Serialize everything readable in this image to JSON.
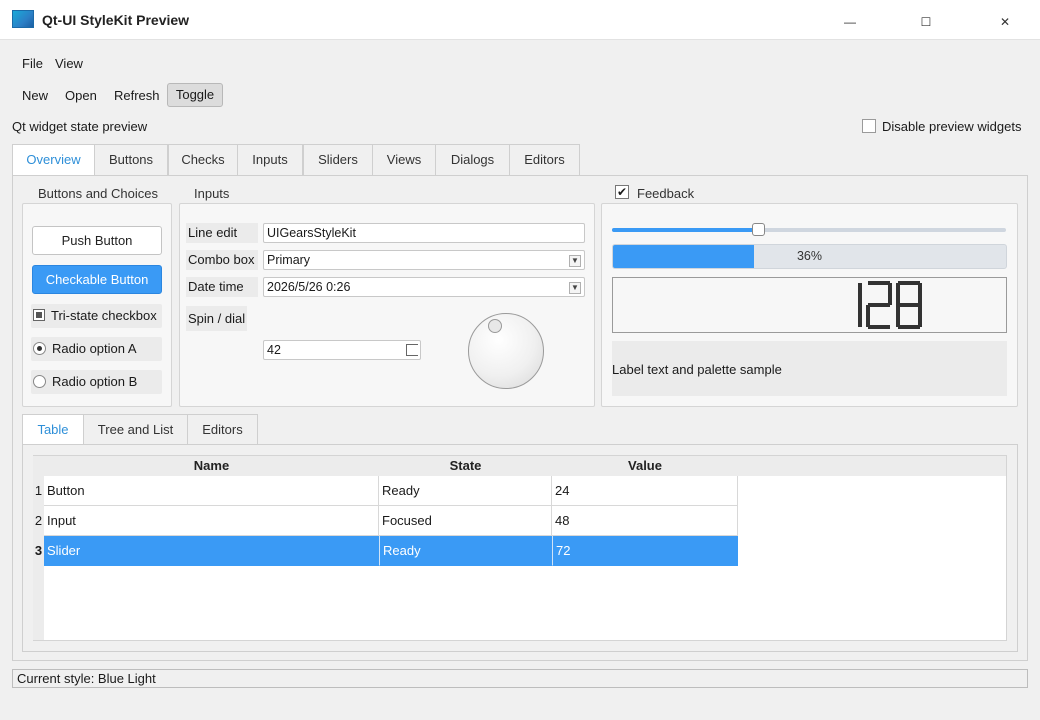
{
  "window": {
    "title": "Qt-UI StyleKit Preview",
    "minimize_glyph": "—",
    "maximize_glyph": "☐",
    "close_glyph": "✕"
  },
  "menubar": {
    "items": [
      "File",
      "View"
    ]
  },
  "toolbar": {
    "items": [
      "New",
      "Open",
      "Refresh"
    ],
    "toggle_label": "Toggle"
  },
  "header": {
    "preview_label": "Qt widget state preview",
    "disable_label": "Disable preview widgets",
    "disable_checked": false
  },
  "tabs": [
    {
      "label": "Overview",
      "active": true
    },
    {
      "label": "Buttons"
    },
    {
      "label": "Checks"
    },
    {
      "label": "Inputs"
    },
    {
      "label": "Sliders"
    },
    {
      "label": "Views"
    },
    {
      "label": "Dialogs"
    },
    {
      "label": "Editors"
    }
  ],
  "buttons_group": {
    "title": "Buttons and Choices",
    "push_button": "Push Button",
    "checkable_button": "Checkable Button",
    "tristate_label": "Tri-state checkbox",
    "radio_a": "Radio option A",
    "radio_b": "Radio option B"
  },
  "inputs_group": {
    "title": "Inputs",
    "line_edit_label": "Line edit",
    "line_edit_value": "UIGearsStyleKit",
    "combo_label": "Combo box",
    "combo_value": "Primary",
    "datetime_label": "Date time",
    "datetime_value": "2026/5/26 0:26",
    "spin_label": "Spin / dial",
    "spin_value": "42"
  },
  "feedback_group": {
    "title": "Feedback",
    "checked": true,
    "slider_level": 0.37,
    "progress_value": 36,
    "progress_text": "36%",
    "lcd_value": "128",
    "palette_label": "Label text and palette sample"
  },
  "bottom_tabs": [
    {
      "label": "Table",
      "active": true
    },
    {
      "label": "Tree and List"
    },
    {
      "label": "Editors"
    }
  ],
  "table": {
    "columns": [
      "Name",
      "State",
      "Value"
    ],
    "rows": [
      {
        "num": "1",
        "name": "Button",
        "state": "Ready",
        "value": "24",
        "selected": false
      },
      {
        "num": "2",
        "name": "Input",
        "state": "Focused",
        "value": "48",
        "selected": false
      },
      {
        "num": "3",
        "name": "Slider",
        "state": "Ready",
        "value": "72",
        "selected": true
      }
    ]
  },
  "status": {
    "text": "Current style: Blue Light"
  },
  "colors": {
    "accent": "#3a9af5",
    "tab_active_text": "#2e8fd8"
  }
}
